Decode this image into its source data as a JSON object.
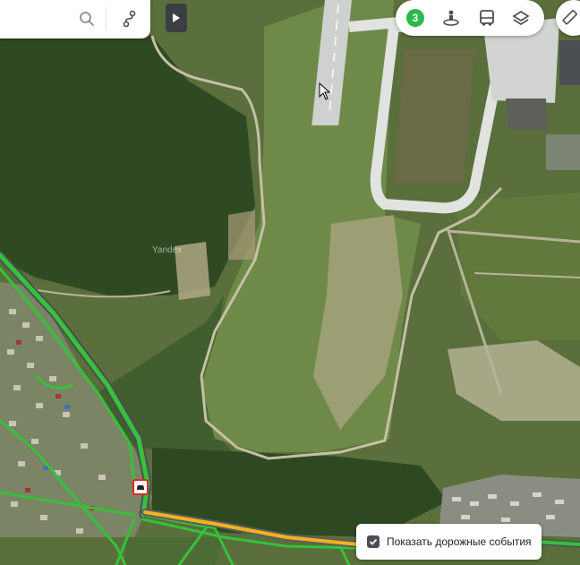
{
  "map": {
    "watermark": "Yandex"
  },
  "search": {
    "search_icon": "search-icon",
    "route_icon": "route-icon"
  },
  "sidebar_toggle": {
    "icon": "play-triangle-icon"
  },
  "layers": {
    "traffic_level": "3",
    "traffic_color": "#2db84a",
    "panorama_icon": "panorama-person-icon",
    "transport_icon": "bus-icon",
    "layers_icon": "layers-icon"
  },
  "ruler": {
    "icon": "ruler-icon"
  },
  "traffic_toggle": {
    "label": "Показать дорожные события",
    "checked": true
  },
  "markers": [
    {
      "type": "road-incident",
      "icon": "car-crash-icon"
    }
  ]
}
